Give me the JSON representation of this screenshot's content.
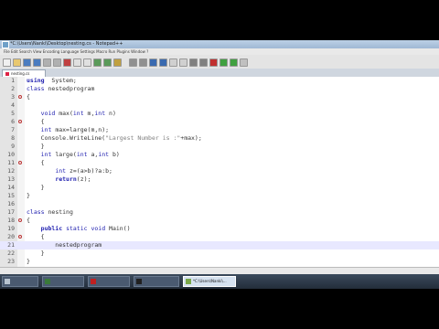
{
  "window": {
    "title": "*C:\\Users\\Nanki\\Desktop\\nesting.cs - Notepad++"
  },
  "menu": {
    "text": "File  Edit  Search  View  Encoding  Language  Settings  Macro  Run  Plugins  Window  ?"
  },
  "tab": {
    "label": "nesting.cs"
  },
  "editor": {
    "lines": [
      {
        "n": "1",
        "fold": "",
        "code": [
          [
            "kwb",
            "using"
          ],
          [
            "",
            "  System;"
          ]
        ]
      },
      {
        "n": "2",
        "fold": "",
        "code": [
          [
            "kw",
            "class"
          ],
          [
            "",
            " nestedprogram"
          ]
        ]
      },
      {
        "n": "3",
        "fold": "open",
        "code": [
          [
            "",
            "{"
          ]
        ]
      },
      {
        "n": "4",
        "fold": "",
        "code": [
          [
            "",
            ""
          ]
        ]
      },
      {
        "n": "5",
        "fold": "",
        "code": [
          [
            "",
            "    "
          ],
          [
            "kw",
            "void"
          ],
          [
            "",
            " max("
          ],
          [
            "kw",
            "int"
          ],
          [
            "",
            " m,"
          ],
          [
            "kw",
            "int"
          ],
          [
            "",
            " n)"
          ]
        ]
      },
      {
        "n": "6",
        "fold": "open",
        "code": [
          [
            "",
            "    {"
          ]
        ]
      },
      {
        "n": "7",
        "fold": "",
        "code": [
          [
            "",
            "    "
          ],
          [
            "kw",
            "int"
          ],
          [
            "",
            " max=large(m,n);"
          ]
        ]
      },
      {
        "n": "8",
        "fold": "",
        "code": [
          [
            "",
            "    Console.WriteLine("
          ],
          [
            "str",
            "\"Largest Number is :\""
          ],
          [
            "",
            "+max);"
          ]
        ]
      },
      {
        "n": "9",
        "fold": "",
        "code": [
          [
            "",
            "    }"
          ]
        ]
      },
      {
        "n": "10",
        "fold": "",
        "code": [
          [
            "",
            "    "
          ],
          [
            "kw",
            "int"
          ],
          [
            "",
            " large("
          ],
          [
            "kw",
            "int"
          ],
          [
            "",
            " a,"
          ],
          [
            "kw",
            "int"
          ],
          [
            "",
            " b)"
          ]
        ]
      },
      {
        "n": "11",
        "fold": "open",
        "code": [
          [
            "",
            "    {"
          ]
        ]
      },
      {
        "n": "12",
        "fold": "",
        "code": [
          [
            "",
            "        "
          ],
          [
            "kw",
            "int"
          ],
          [
            "",
            " z=(a>b)?a:b;"
          ]
        ]
      },
      {
        "n": "13",
        "fold": "",
        "code": [
          [
            "",
            "        "
          ],
          [
            "kwb",
            "return"
          ],
          [
            "",
            "(z);"
          ]
        ]
      },
      {
        "n": "14",
        "fold": "",
        "code": [
          [
            "",
            "    }"
          ]
        ]
      },
      {
        "n": "15",
        "fold": "",
        "code": [
          [
            "",
            "}"
          ]
        ]
      },
      {
        "n": "16",
        "fold": "",
        "code": [
          [
            "",
            ""
          ]
        ]
      },
      {
        "n": "17",
        "fold": "",
        "code": [
          [
            "kw",
            "class"
          ],
          [
            "",
            " nesting"
          ]
        ]
      },
      {
        "n": "18",
        "fold": "open",
        "code": [
          [
            "",
            "{"
          ]
        ]
      },
      {
        "n": "19",
        "fold": "",
        "code": [
          [
            "",
            "    "
          ],
          [
            "kwb",
            "public"
          ],
          [
            "",
            " "
          ],
          [
            "kw",
            "static"
          ],
          [
            "",
            " "
          ],
          [
            "kw",
            "void"
          ],
          [
            "",
            " Main()"
          ]
        ]
      },
      {
        "n": "20",
        "fold": "open",
        "code": [
          [
            "",
            "    {"
          ]
        ]
      },
      {
        "n": "21",
        "fold": "",
        "current": true,
        "code": [
          [
            "",
            "        nestedprogram"
          ]
        ]
      },
      {
        "n": "22",
        "fold": "",
        "code": [
          [
            "",
            "    }"
          ]
        ]
      },
      {
        "n": "23",
        "fold": "",
        "code": [
          [
            "",
            "}"
          ]
        ]
      }
    ]
  },
  "taskbar": {
    "items": [
      {
        "label": "",
        "icon_color": "#b8c4d0",
        "active": false
      },
      {
        "label": "",
        "icon_color": "#3a7a3a",
        "active": false
      },
      {
        "label": "",
        "icon_color": "#c02020",
        "active": false
      },
      {
        "label": "",
        "icon_color": "#202020",
        "active": false
      },
      {
        "label": "*C:\\Users\\Nanki\\...",
        "icon_color": "#7aa84a",
        "active": true
      }
    ]
  }
}
